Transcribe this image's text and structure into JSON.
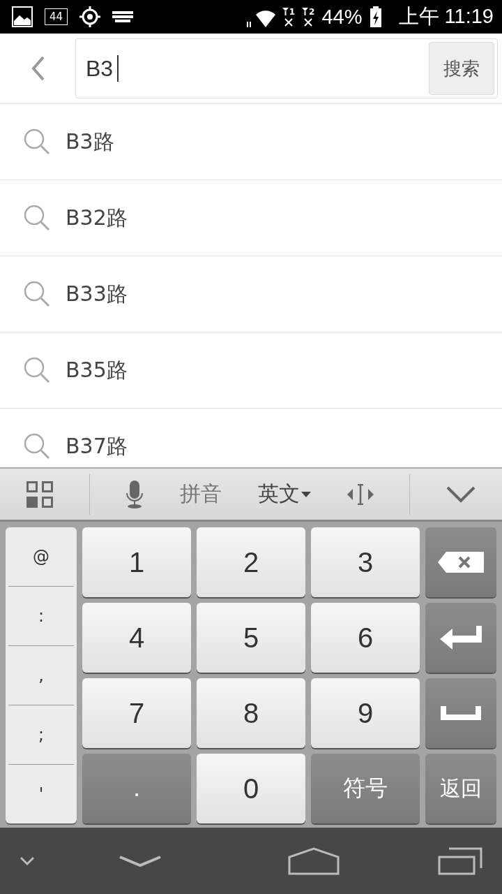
{
  "status_bar": {
    "notification_badge": "44",
    "sims": [
      "1",
      "2"
    ],
    "battery": "44%",
    "time": "上午 11:19"
  },
  "search": {
    "value": "B3",
    "button": "搜索"
  },
  "suggestions": [
    "B3路",
    "B32路",
    "B33路",
    "B35路",
    "B37路"
  ],
  "keyboard_toolbar": {
    "pinyin": "拼音",
    "language": "英文"
  },
  "symbols": [
    "@",
    ":",
    ",",
    ";",
    "'"
  ],
  "keys": [
    {
      "kind": "light",
      "label": "1"
    },
    {
      "kind": "light",
      "label": "2"
    },
    {
      "kind": "light",
      "label": "3"
    },
    {
      "kind": "backspace"
    },
    {
      "kind": "light",
      "label": "4"
    },
    {
      "kind": "light",
      "label": "5"
    },
    {
      "kind": "light",
      "label": "6"
    },
    {
      "kind": "enter"
    },
    {
      "kind": "light",
      "label": "7"
    },
    {
      "kind": "light",
      "label": "8"
    },
    {
      "kind": "light",
      "label": "9"
    },
    {
      "kind": "space"
    },
    {
      "kind": "dark",
      "label": "."
    },
    {
      "kind": "light",
      "label": "0"
    },
    {
      "kind": "dark",
      "label": "符号"
    },
    {
      "kind": "dark",
      "label": "返回"
    }
  ]
}
